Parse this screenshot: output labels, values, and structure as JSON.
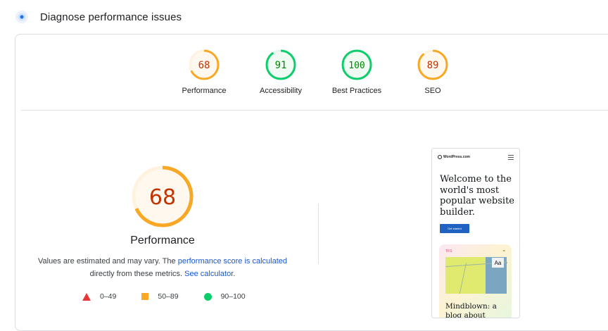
{
  "header": {
    "title": "Diagnose performance issues",
    "icon": "lighthouse-pulse-icon"
  },
  "colors": {
    "fail": "#e53935",
    "average": "#f9a825",
    "pass": "#0cce6b",
    "link": "#1558d6"
  },
  "scores": [
    {
      "label": "Performance",
      "value": "68",
      "fraction": 0.68,
      "rating": "average"
    },
    {
      "label": "Accessibility",
      "value": "91",
      "fraction": 0.91,
      "rating": "pass"
    },
    {
      "label": "Best Practices",
      "value": "100",
      "fraction": 1.0,
      "rating": "pass"
    },
    {
      "label": "SEO",
      "value": "89",
      "fraction": 0.89,
      "rating": "average"
    }
  ],
  "detail": {
    "value": "68",
    "fraction": 0.68,
    "label": "Performance",
    "note_prefix": "Values are estimated and may vary. The ",
    "note_link1": "performance score is calculated",
    "note_mid": " directly from these metrics. ",
    "note_link2": "See calculator",
    "note_suffix": "."
  },
  "legend": [
    {
      "symbol": "triangle",
      "range": "0–49"
    },
    {
      "symbol": "square",
      "range": "50–89"
    },
    {
      "symbol": "circle",
      "range": "90–100"
    }
  ],
  "preview": {
    "logo": "WordPress.com",
    "headline": "Welcome to the world's most popular website builder.",
    "button": "Get started",
    "card_tag": "TFS",
    "card_aa": "Aa",
    "card_text": "Mindblown: a blog about philosophy."
  }
}
